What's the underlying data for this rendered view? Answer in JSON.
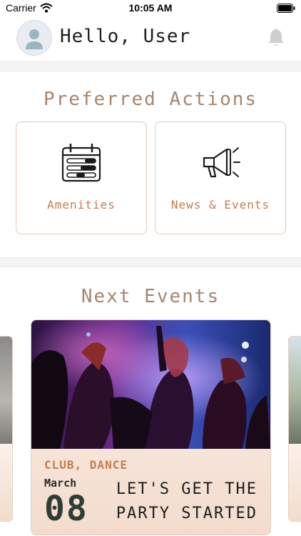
{
  "status_bar": {
    "carrier": "Carrier",
    "time": "10:05 AM"
  },
  "header": {
    "greeting": "Hello, User"
  },
  "preferred_actions": {
    "title": "Preferred Actions",
    "items": [
      {
        "label": "Amenities",
        "icon": "calendar-icon"
      },
      {
        "label": "News & Events",
        "icon": "megaphone-icon"
      }
    ]
  },
  "next_events": {
    "title": "Next Events",
    "featured": {
      "tags": "CLUB, DANCE",
      "month": "March",
      "day": "08",
      "title": "LET'S GET THE PARTY STARTED"
    }
  },
  "colors": {
    "accent": "#c27d52",
    "section_title": "#a5866f",
    "card_border": "#e6c9b4"
  }
}
